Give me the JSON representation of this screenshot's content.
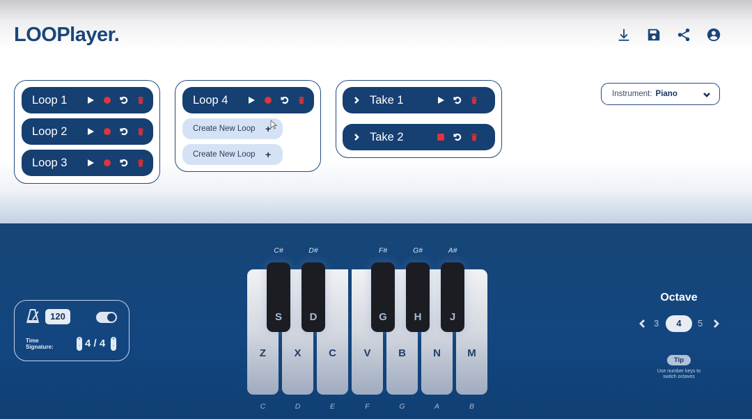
{
  "app": {
    "title": "LOOPlayer."
  },
  "header": {
    "icons": [
      {
        "name": "download-icon",
        "label": "Download"
      },
      {
        "name": "save-icon",
        "label": "Save"
      },
      {
        "name": "share-icon",
        "label": "Share"
      },
      {
        "name": "account-icon",
        "label": "Account"
      }
    ]
  },
  "loop_groups": [
    {
      "loops": [
        {
          "label": "Loop 1",
          "state": "idle"
        },
        {
          "label": "Loop 2",
          "state": "idle"
        },
        {
          "label": "Loop 3",
          "state": "idle"
        }
      ]
    },
    {
      "loops": [
        {
          "label": "Loop 4",
          "state": "idle"
        }
      ],
      "create_buttons": [
        {
          "label": "Create New Loop",
          "icon": "+"
        },
        {
          "label": "Create New Loop",
          "icon": "+"
        }
      ]
    }
  ],
  "takes": [
    {
      "label": "Take 1",
      "state": "stopped"
    },
    {
      "label": "Take 2",
      "state": "recording"
    }
  ],
  "instrument": {
    "label": "Instrument:",
    "value": "Piano"
  },
  "metronome": {
    "bpm": "120",
    "enabled": true,
    "time_signature_label_1": "Time",
    "time_signature_label_2": "Signature:",
    "time_signature": "4 / 4",
    "step_up": "+",
    "step_down": "-"
  },
  "piano": {
    "white_keys": [
      {
        "note": "C",
        "key": "Z"
      },
      {
        "note": "D",
        "key": "X"
      },
      {
        "note": "E",
        "key": "C"
      },
      {
        "note": "F",
        "key": "V"
      },
      {
        "note": "G",
        "key": "B"
      },
      {
        "note": "A",
        "key": "N"
      },
      {
        "note": "B",
        "key": "M"
      }
    ],
    "black_keys": [
      {
        "note": "C#",
        "key": "S"
      },
      {
        "note": "D#",
        "key": "D"
      },
      {
        "note": "F#",
        "key": "G"
      },
      {
        "note": "G#",
        "key": "H"
      },
      {
        "note": "A#",
        "key": "J"
      }
    ]
  },
  "octave": {
    "title": "Octave",
    "prev": "3",
    "current": "4",
    "next": "5",
    "tip_label": "Tip",
    "tip_line1": "Use number keys to",
    "tip_line2": "switch octaves"
  },
  "colors": {
    "brand": "#1a4679",
    "pill": "#163f72",
    "record": "#e0343d",
    "bottom_panel": "#134680",
    "create_button": "#d5e2f5"
  }
}
